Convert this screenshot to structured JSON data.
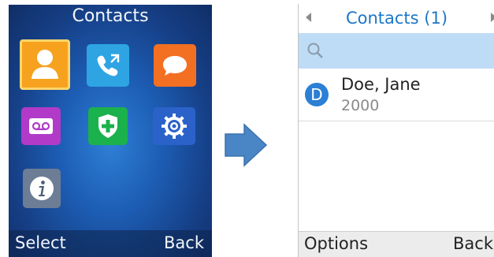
{
  "left_screen": {
    "title": "Contacts",
    "apps": [
      {
        "name": "contacts-icon"
      },
      {
        "name": "calls-icon"
      },
      {
        "name": "messages-icon"
      },
      {
        "name": "voicemail-icon"
      },
      {
        "name": "security-icon"
      },
      {
        "name": "settings-icon"
      },
      {
        "name": "info-icon"
      }
    ],
    "softkeys": {
      "left": "Select",
      "right": "Back"
    }
  },
  "arrow": {
    "icon": "right-arrow-icon",
    "color": "#4a86c6"
  },
  "right_screen": {
    "title": "Contacts (1)",
    "search": {
      "icon": "search-icon"
    },
    "contacts": [
      {
        "initial": "D",
        "name": "Doe, Jane",
        "number": "2000"
      }
    ],
    "softkeys": {
      "left": "Options",
      "right": "Back"
    }
  },
  "colors": {
    "accent": "#1c77c7",
    "search_bg": "#bfdcf6",
    "avatar": "#2b7fd4"
  }
}
